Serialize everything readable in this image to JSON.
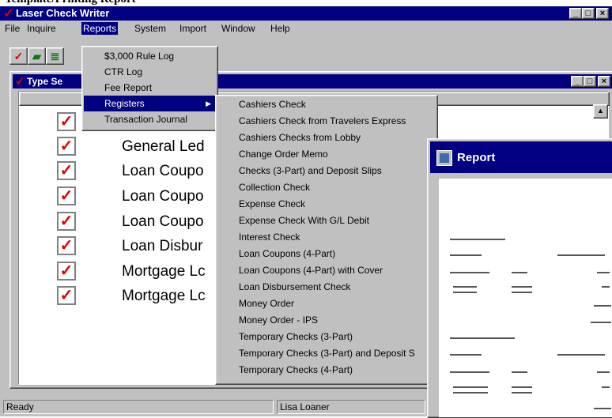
{
  "caption": "Template/Printing Report",
  "app": {
    "title": "Laser Check Writer",
    "window_buttons": [
      "_",
      "□",
      "×"
    ]
  },
  "menubar": [
    "File",
    "Inquire",
    "Reports",
    "System",
    "Import",
    "Window",
    "Help"
  ],
  "toolbar": {
    "icons": [
      "check-icon",
      "money-icon",
      "money-stack-icon"
    ]
  },
  "child_window": {
    "title": "Type Se",
    "items": [
      {
        "label": ""
      },
      {
        "label": "General Led"
      },
      {
        "label": "Loan Coupo"
      },
      {
        "label": "Loan Coupo"
      },
      {
        "label": "Loan Coupo"
      },
      {
        "label": "Loan Disbur"
      },
      {
        "label": "Mortgage Lc"
      },
      {
        "label": "Mortgage Lc"
      }
    ]
  },
  "reports_menu": [
    {
      "label": "$3,000 Rule Log"
    },
    {
      "label": "CTR Log"
    },
    {
      "label": "Fee Report"
    },
    {
      "label": "Registers",
      "selected": true
    },
    {
      "label": "Transaction Journal"
    }
  ],
  "registers_submenu": [
    "Cashiers Check",
    "Cashiers Check from Travelers Express",
    "Cashiers Checks from Lobby",
    "Change Order Memo",
    "Checks (3-Part) and Deposit Slips",
    "Collection Check",
    "Expense Check",
    "Expense Check With G/L Debit",
    "Interest Check",
    "Loan Coupons (4-Part)",
    "Loan Coupons (4-Part) with Cover",
    "Loan Disbursement Check",
    "Money Order",
    "Money Order - IPS",
    "Temporary Checks (3-Part)",
    "Temporary Checks (3-Part) and Deposit S",
    "Temporary Checks (4-Part)"
  ],
  "report_window": {
    "title": "Report"
  },
  "status": {
    "left": "Ready",
    "user": "Lisa Loaner"
  },
  "colors": {
    "titlebar": "#000080",
    "face": "#c0c0c0",
    "check": "#e00000"
  }
}
